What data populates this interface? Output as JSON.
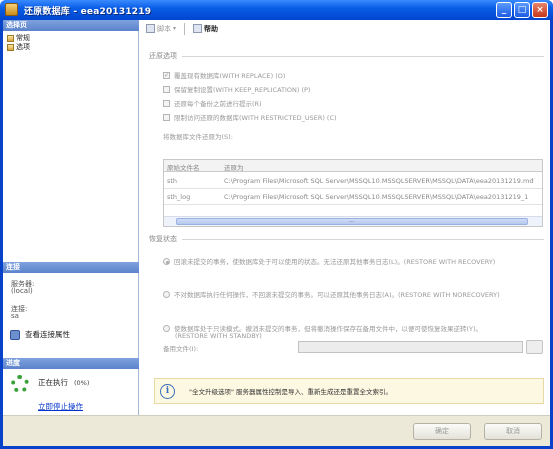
{
  "window": {
    "title": "还原数据库 - eea20131219",
    "controls": {
      "minimize": "_",
      "maximize": "□",
      "close": "×"
    }
  },
  "sidebar": {
    "select_page_header": "选择页",
    "pages": [
      {
        "label": "常规"
      },
      {
        "label": "选项"
      }
    ],
    "connection": {
      "header": "连接",
      "server_label": "服务器:",
      "server_value": "(local)",
      "conn_label": "连接:",
      "conn_value": "sa",
      "view_props_link": "查看连接属性"
    },
    "progress": {
      "header": "进度",
      "status": "正在执行",
      "percent": "(0%)",
      "stop_link": "立即停止操作"
    }
  },
  "toolbar": {
    "script_label": "脚本",
    "help_label": "帮助"
  },
  "restore_options": {
    "group_title": "还原选项",
    "overwrite": {
      "label": "覆盖现有数据库(WITH REPLACE) (O)",
      "checked": true
    },
    "keep_replication": {
      "label": "保留复制设置(WITH KEEP_REPLICATION) (P)",
      "checked": false
    },
    "prompt_each": {
      "label": "还原每个备份之前进行提示(R)",
      "checked": false
    },
    "restrict_user": {
      "label": "限制访问还原的数据库(WITH RESTRICTED_USER) (C)",
      "checked": false
    }
  },
  "restore_files": {
    "caption": "将数据库文件还原为(S):",
    "columns": [
      "原始文件名",
      "还原为"
    ],
    "rows": [
      [
        "sth",
        "C:\\Program Files\\Microsoft SQL Server\\MSSQL10.MSSQLSERVER\\MSSQL\\DATA\\eea20131219.mdf"
      ],
      [
        "sth_log",
        "C:\\Program Files\\Microsoft SQL Server\\MSSQL10.MSSQLSERVER\\MSSQL\\DATA\\eea20131219_1"
      ]
    ],
    "scroll_arrow": "..."
  },
  "recovery_state": {
    "group_title": "恢复状态",
    "options": [
      {
        "label": "回滚未提交的事务，使数据库处于可以使用的状态。无法还原其他事务日志(L)。(RESTORE WITH RECOVERY)",
        "selected": true
      },
      {
        "label": "不对数据库执行任何操作，不回滚未提交的事务。可以还原其他事务日志(A)。(RESTORE WITH NORECOVERY)",
        "selected": false
      },
      {
        "label1": "使数据库处于只读模式。撤消未提交的事务，但将撤消操作保存在备用文件中，以便可使恢复效果逆转(Y)。",
        "label2": "(RESTORE WITH STANDBY)",
        "selected": false
      }
    ],
    "standby_file_label": "备用文件(I):",
    "standby_file_value": ""
  },
  "info": {
    "message": "\"全文升级选项\" 服务器属性控制是导入、重新生成还是重置全文索引。"
  },
  "buttons": {
    "ok": "确定",
    "cancel": "取消"
  },
  "colors": {
    "titlebar": "#0a5ee6",
    "section_header": "#5b82cb",
    "spinner": "#3aa03a"
  }
}
